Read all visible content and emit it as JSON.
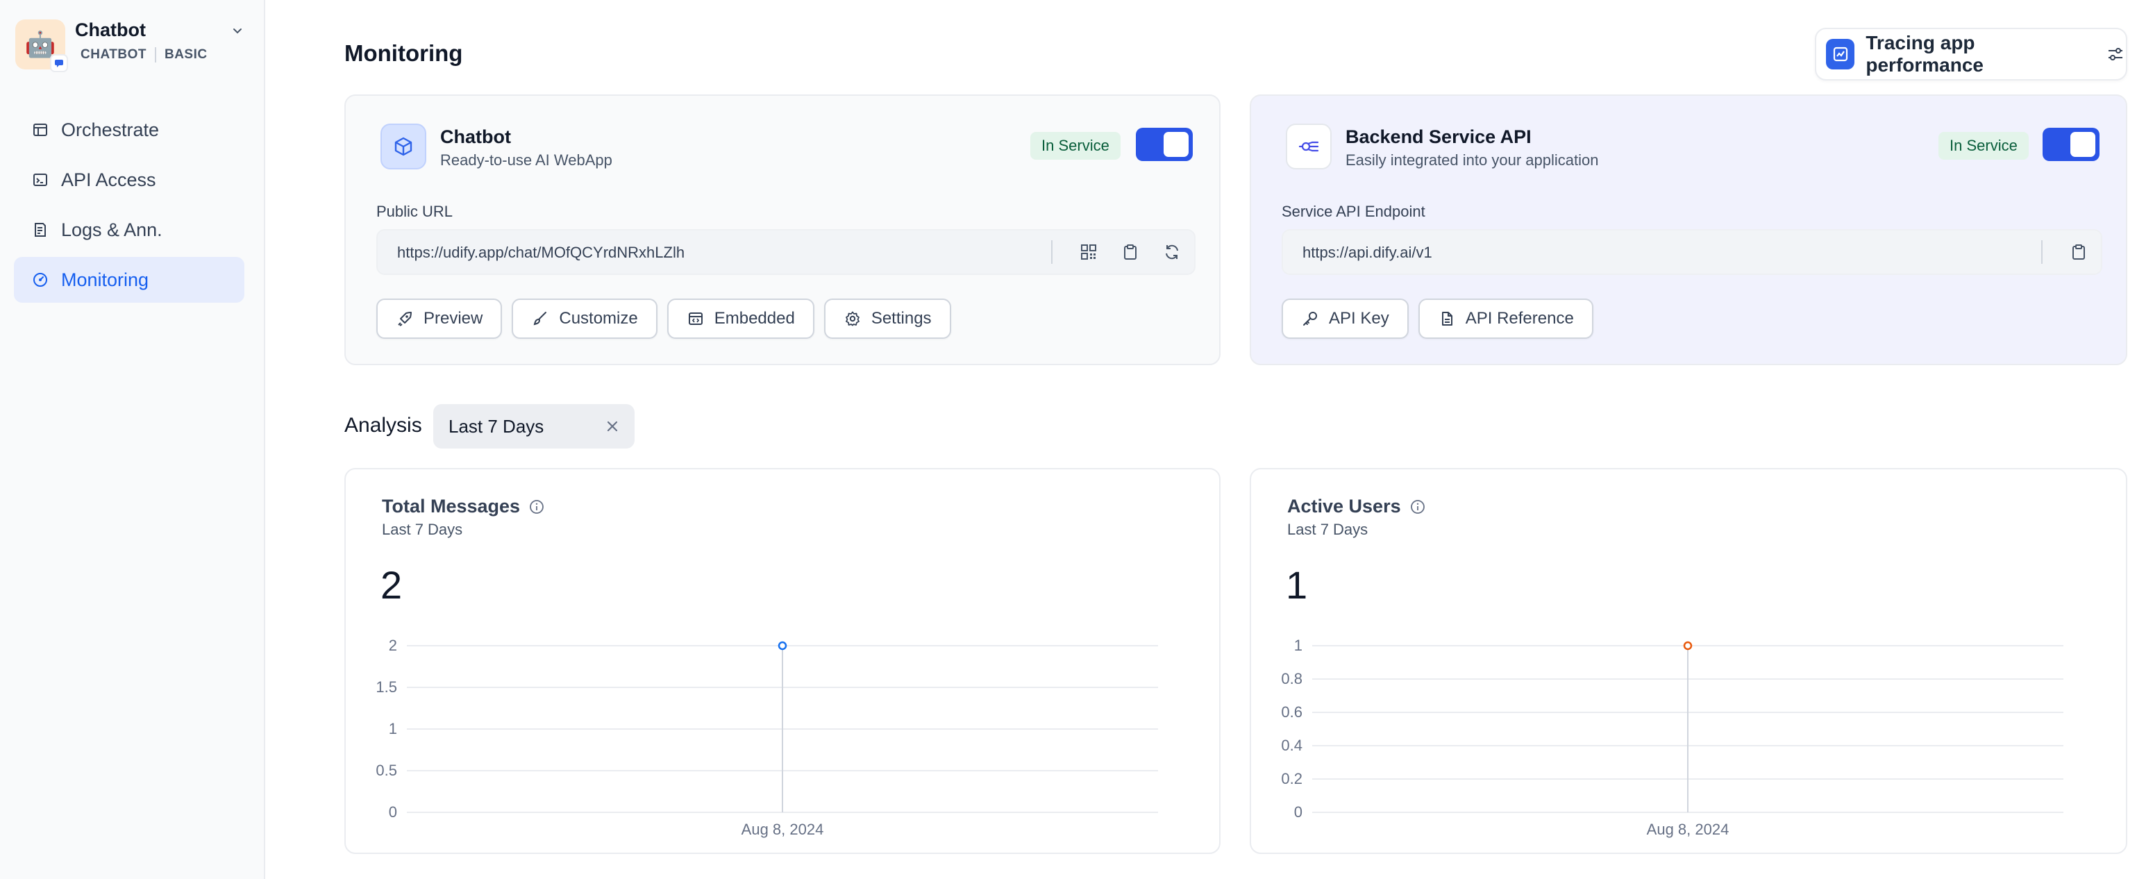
{
  "app": {
    "name": "Chatbot",
    "tag_type": "CHATBOT",
    "tag_mode": "BASIC",
    "icon_emoji": "🤖"
  },
  "sidebar": {
    "items": [
      {
        "label": "Orchestrate",
        "icon": "layout-icon",
        "active": false
      },
      {
        "label": "API Access",
        "icon": "terminal-icon",
        "active": false
      },
      {
        "label": "Logs & Ann.",
        "icon": "file-list-icon",
        "active": false
      },
      {
        "label": "Monitoring",
        "icon": "dashboard-gauge-icon",
        "active": true
      }
    ]
  },
  "page": {
    "title": "Monitoring"
  },
  "tracing": {
    "label": "Tracing app performance"
  },
  "webapp_card": {
    "title": "Chatbot",
    "subtitle": "Ready-to-use AI WebApp",
    "status": "In Service",
    "enabled": true,
    "field_label": "Public URL",
    "url": "https://udify.app/chat/MOfQCYrdNRxhLZlh",
    "buttons": {
      "preview": "Preview",
      "customize": "Customize",
      "embedded": "Embedded",
      "settings": "Settings"
    }
  },
  "api_card": {
    "title": "Backend Service API",
    "subtitle": "Easily integrated into your application",
    "status": "In Service",
    "enabled": true,
    "field_label": "Service API Endpoint",
    "url": "https://api.dify.ai/v1",
    "buttons": {
      "api_key": "API Key",
      "api_reference": "API Reference"
    }
  },
  "analysis": {
    "label": "Analysis",
    "range": "Last 7 Days"
  },
  "metrics": {
    "total_messages": {
      "title": "Total Messages",
      "period": "Last 7 Days",
      "value": "2"
    },
    "active_users": {
      "title": "Active Users",
      "period": "Last 7 Days",
      "value": "1"
    }
  },
  "colors": {
    "accent": "#155eef",
    "toggle_on": "#2a54e6",
    "badge_bg": "#e3f4ea",
    "badge_text": "#085d3a",
    "series_messages": "#1570ef",
    "series_users": "#e8590c"
  },
  "chart_data": [
    {
      "type": "line",
      "x": [
        "Aug 8, 2024"
      ],
      "series": [
        {
          "values": [
            2
          ]
        }
      ],
      "yticks": [
        "0",
        "0.5",
        "1",
        "1.5",
        "2"
      ],
      "ylim": [
        0,
        2
      ],
      "grid": true
    },
    {
      "type": "line",
      "x": [
        "Aug 8, 2024"
      ],
      "series": [
        {
          "values": [
            1
          ]
        }
      ],
      "yticks": [
        "0",
        "0.2",
        "0.4",
        "0.6",
        "0.8",
        "1"
      ],
      "ylim": [
        0,
        1
      ],
      "grid": true
    }
  ]
}
